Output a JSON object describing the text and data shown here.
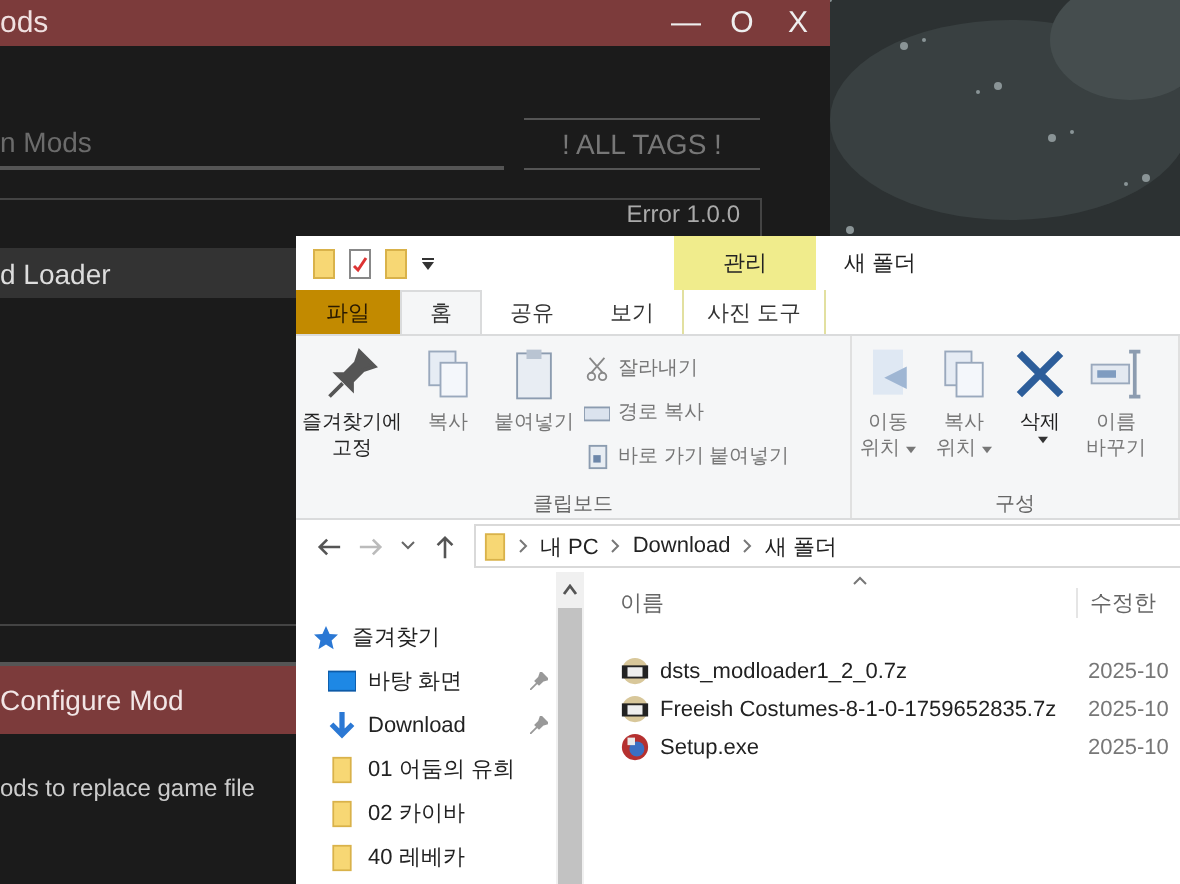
{
  "mod_window": {
    "title": "ods",
    "controls": [
      "—",
      "O",
      "X"
    ],
    "search": {
      "placeholder": "n Mods"
    },
    "tags_button": "! ALL TAGS !",
    "list_info": "Error  1.0.0",
    "mods": [
      {
        "name": "d Loader",
        "selected": true
      }
    ],
    "configure_button": "Configure Mod",
    "description": "ods to replace game file"
  },
  "explorer": {
    "title": "새 폴더",
    "context_tab": "관리",
    "tabs": [
      {
        "label": "파일",
        "kind": "file",
        "selected": false
      },
      {
        "label": "홈",
        "kind": "tab",
        "selected": true
      },
      {
        "label": "공유",
        "kind": "tab",
        "selected": false
      },
      {
        "label": "보기",
        "kind": "tab",
        "selected": false
      },
      {
        "label": "사진 도구",
        "kind": "context",
        "selected": false
      }
    ],
    "ribbon_groups": [
      {
        "label": "클립보드",
        "items": [
          {
            "kind": "large",
            "lines": [
              "즐겨찾기에",
              "고정"
            ],
            "disabled": false
          },
          {
            "kind": "large",
            "lines": [
              "복사"
            ],
            "disabled": true
          },
          {
            "kind": "large",
            "lines": [
              "붙여넣기"
            ],
            "disabled": true
          },
          {
            "kind": "small",
            "lines": [
              "잘라내기"
            ],
            "disabled": true
          },
          {
            "kind": "small",
            "lines": [
              "경로 복사"
            ],
            "disabled": true
          },
          {
            "kind": "small",
            "lines": [
              "바로 가기 붙여넣기"
            ],
            "disabled": true
          }
        ]
      },
      {
        "label": "구성",
        "items": [
          {
            "kind": "large",
            "lines": [
              "이동",
              "위치"
            ],
            "disabled": true,
            "dropdown": true
          },
          {
            "kind": "large",
            "lines": [
              "복사",
              "위치"
            ],
            "disabled": true,
            "dropdown": true
          },
          {
            "kind": "large",
            "lines": [
              "삭제"
            ],
            "disabled": false,
            "dropdown": true
          },
          {
            "kind": "large",
            "lines": [
              "이름",
              "바꾸기"
            ],
            "disabled": true,
            "dropdown": false
          }
        ]
      }
    ],
    "path": [
      "내 PC",
      "Download",
      "새 폴더"
    ],
    "nav": [
      {
        "label": "즐겨찾기",
        "kind": "star",
        "children": [
          {
            "label": "바탕 화면",
            "kind": "desktop",
            "pinned": true
          },
          {
            "label": "Download",
            "kind": "download",
            "pinned": true
          },
          {
            "label": "01 어둠의 유희",
            "kind": "folder",
            "pinned": false
          },
          {
            "label": "02 카이바",
            "kind": "folder",
            "pinned": false
          },
          {
            "label": "40 레베카",
            "kind": "folder",
            "pinned": false
          }
        ]
      }
    ],
    "columns": [
      "이름",
      "수정한"
    ],
    "files": [
      {
        "name": "dsts_modloader1_2_0.7z",
        "kind": "archive",
        "date": "2025-10"
      },
      {
        "name": "Freeish Costumes-8-1-0-1759652835.7z",
        "kind": "archive",
        "date": "2025-10"
      },
      {
        "name": "Setup.exe",
        "kind": "exe",
        "date": "2025-10"
      }
    ]
  }
}
